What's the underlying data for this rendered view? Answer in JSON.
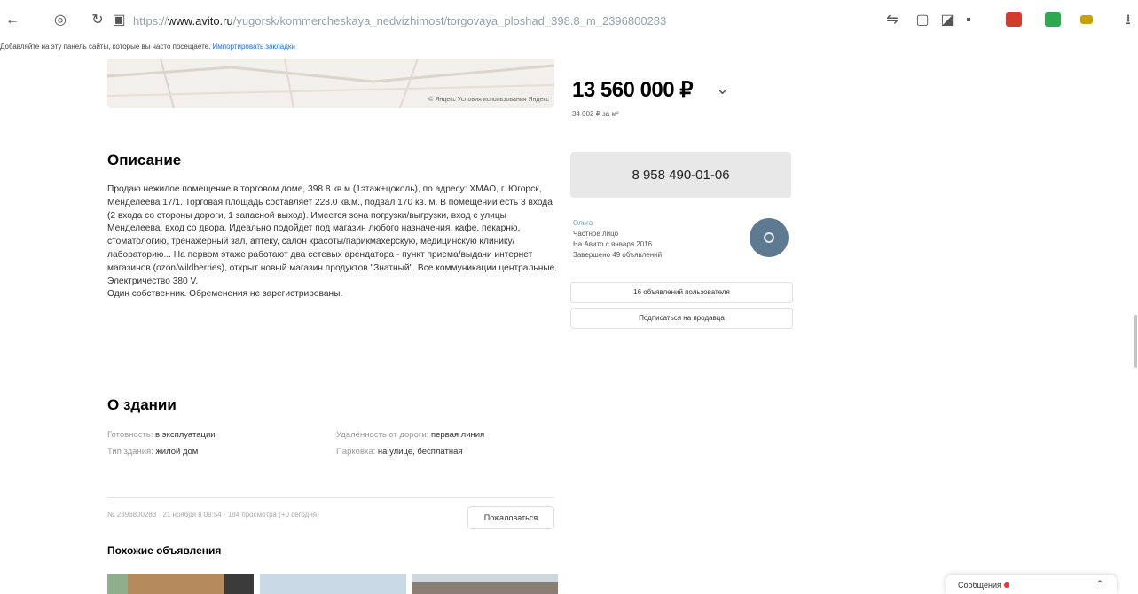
{
  "browser": {
    "url_prefix": "https://",
    "url_host": "www.avito.ru",
    "url_path": "/yugorsk/kommercheskaya_nedvizhimost/torgovaya_ploshad_398.8_m_2396800283"
  },
  "bookmarks_bar": {
    "hint": "Добавляйте на эту панель сайты, которые вы часто посещаете.",
    "link": "Импортировать закладки"
  },
  "map": {
    "attribution": "© Яндекс  Условия использования  Яндекс"
  },
  "listing": {
    "price": "13 560 000 ₽",
    "price_per_m2": "34 002 ₽ за м²"
  },
  "contact": {
    "phone": "8 958 490-01-06"
  },
  "seller": {
    "name": "Ольга",
    "type": "Частное лицо",
    "since": "На Авито с января 2016",
    "completed": "Завершено 49 объявлений",
    "ads_button": "16 объявлений пользователя",
    "subscribe_button": "Подписаться на продавца"
  },
  "description": {
    "heading": "Описание",
    "text": "Продаю нежилое помещение в торговом доме, 398.8 кв.м (1этаж+цоколь), по адресу: ХМАО, г. Югорск, Менделеева 17/1. Торговая площадь составляет 228.0 кв.м., подвал 170 кв. м. В помещении есть 3 входа (2 входа со стороны дороги, 1 запасной выход). Имеется зона погрузки/выгрузки, вход с улицы Менделеева, вход со двора. Идеально подойдет под магазин любого назначения, кафе, пекарню, стоматологию, тренажерный зал, аптеку, салон красоты/парикмахерскую, медицинскую клинику/лабораторию... На первом этаже работают два сетевых арендатора - пункт приема/выдачи интернет магазинов (ozon/wildberries), открыт новый магазин продуктов \"Знатный\". Все коммуникации центральные. Электричество 380 V.",
    "footer": "Один собственник. Обременения не зарегистрированы."
  },
  "building": {
    "heading": "О здании",
    "props": [
      {
        "label": "Готовность",
        "value": "в эксплуатации"
      },
      {
        "label": "Тип здания",
        "value": "жилой дом"
      },
      {
        "label": "Удалённость от дороги",
        "value": "первая линия"
      },
      {
        "label": "Парковка",
        "value": "на улице, бесплатная"
      }
    ]
  },
  "meta": {
    "info": "№ 2396800283 · 21 ноября в 09:54 · 184 просмотра (+0 сегодня)",
    "complain_button": "Пожаловаться"
  },
  "similar": {
    "heading": "Похожие объявления"
  },
  "chat": {
    "label": "Сообщения"
  }
}
